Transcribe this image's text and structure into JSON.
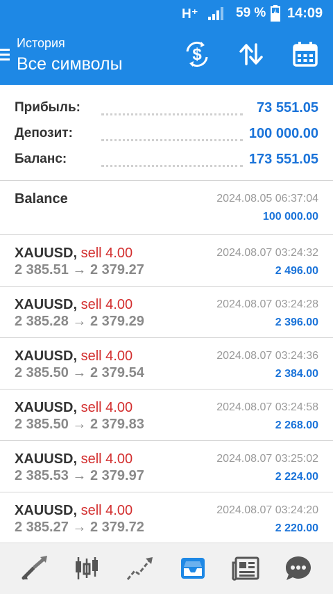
{
  "status_bar": {
    "network": "H⁺",
    "battery_pct": "59 %",
    "time": "14:09"
  },
  "header": {
    "subtitle": "История",
    "title": "Все символы"
  },
  "summary": [
    {
      "label": "Прибыль:",
      "value": "73 551.05"
    },
    {
      "label": "Депозит:",
      "value": "100 000.00"
    },
    {
      "label": "Баланс:",
      "value": "173 551.05"
    }
  ],
  "balance_entry": {
    "label": "Balance",
    "time": "2024.08.05 06:37:04",
    "amount": "100 000.00"
  },
  "deals": [
    {
      "symbol": "XAUUSD",
      "comma": ",",
      "side": "sell 4.00",
      "prices": "2 385.51 → 2 379.27",
      "time": "2024.08.07 03:24:32",
      "profit": "2 496.00"
    },
    {
      "symbol": "XAUUSD",
      "comma": ",",
      "side": "sell 4.00",
      "prices": "2 385.28 → 2 379.29",
      "time": "2024.08.07 03:24:28",
      "profit": "2 396.00"
    },
    {
      "symbol": "XAUUSD",
      "comma": ",",
      "side": "sell 4.00",
      "prices": "2 385.50 → 2 379.54",
      "time": "2024.08.07 03:24:36",
      "profit": "2 384.00"
    },
    {
      "symbol": "XAUUSD",
      "comma": ",",
      "side": "sell 4.00",
      "prices": "2 385.50 → 2 379.83",
      "time": "2024.08.07 03:24:58",
      "profit": "2 268.00"
    },
    {
      "symbol": "XAUUSD",
      "comma": ",",
      "side": "sell 4.00",
      "prices": "2 385.53 → 2 379.97",
      "time": "2024.08.07 03:25:02",
      "profit": "2 224.00"
    },
    {
      "symbol": "XAUUSD",
      "comma": ",",
      "side": "sell 4.00",
      "prices": "2 385.27 → 2 379.72",
      "time": "2024.08.07 03:24:20",
      "profit": "2 220.00"
    }
  ],
  "colors": {
    "accent": "#1e88e5",
    "value_blue": "#1a73d9",
    "sell_red": "#d32f2f"
  },
  "icons": {
    "header_actions": [
      "currency-exchange-icon",
      "sort-icon",
      "calendar-icon"
    ],
    "bottom_nav": [
      "quotes-icon",
      "chart-icon",
      "trade-icon",
      "history-icon",
      "news-icon",
      "messages-icon"
    ],
    "active_nav": "history-icon"
  }
}
